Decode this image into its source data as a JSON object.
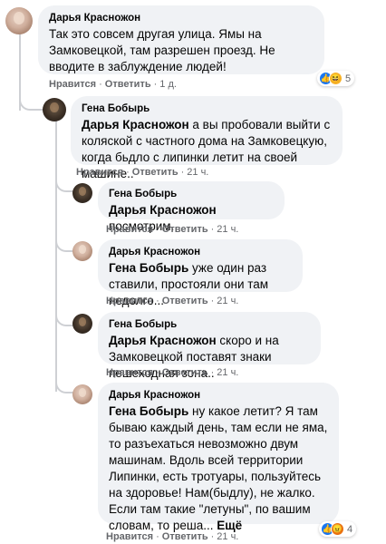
{
  "comments": [
    {
      "author": "Дарья Красножон",
      "text": "Так это совсем другая улица. Ямы на Замковецкой, там разрешен проезд. Не вводите в заблуждение людей!",
      "like": "Нравится",
      "reply": "Ответить",
      "time": "1 д.",
      "reaction_count": "5",
      "reactions": [
        "like",
        "haha"
      ]
    },
    {
      "author": "Гена Бобырь",
      "mention": "Дарья Красножон",
      "text": " а вы пробовали выйти с коляской с частного дома на Замковецкую, когда бьдло с липинки летит на своей машине..",
      "like": "Нравится",
      "reply": "Ответить",
      "time": "21 ч."
    },
    {
      "author": "Гена Бобырь",
      "mention": "Дарья Красножон",
      "text": " посмотрим..",
      "like": "Нравится",
      "reply": "Ответить",
      "time": "21 ч."
    },
    {
      "author": "Дарья Красножон",
      "mention": "Гена Бобырь",
      "text": " уже один раз ставили, простояли они там недолго...",
      "like": "Нравится",
      "reply": "Ответить",
      "time": "21 ч."
    },
    {
      "author": "Гена Бобырь",
      "mention": "Дарья Красножон",
      "text": " скоро и на Замковецкой поставят знаки пешеходная зона..",
      "like": "Нравится",
      "reply": "Ответить",
      "time": "21 ч."
    },
    {
      "author": "Дарья Красножон",
      "mention": "Гена Бобырь",
      "text": " ну какое летит? Я там бываю каждый день, там если не яма, то разъехаться невозможно двум машинам. Вдоль всей территории Липинки, есть тротуары, пользуйтесь на здоровье! Нам(быдлу), не жалко.\nЕсли там такие \"летуны\", по вашим словам, то реша...",
      "more": "Ещё",
      "like": "Нравится",
      "reply": "Ответить",
      "time": "21 ч.",
      "reaction_count": "4",
      "reactions": [
        "like",
        "angry"
      ]
    }
  ],
  "separator": "·",
  "icons": {
    "like": "👍",
    "haha": "😆",
    "angry": "😠"
  },
  "colors": {
    "bubble": "#f0f2f5",
    "meta": "#65676b",
    "like": "#1877f2"
  }
}
